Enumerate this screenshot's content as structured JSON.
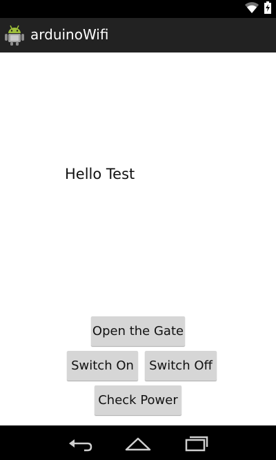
{
  "status_bar": {
    "icons": [
      "wifi-icon",
      "battery-charging-icon"
    ]
  },
  "action_bar": {
    "title": "arduinoWifi",
    "icon": "android-robot-icon"
  },
  "main": {
    "message": "Hello Test",
    "buttons": {
      "open_gate": "Open the Gate",
      "switch_on": "Switch On",
      "switch_off": "Switch Off",
      "check_power": "Check Power"
    },
    "button_color": "#d6d6d6"
  },
  "nav_bar": {
    "icons": [
      "back-icon",
      "home-icon",
      "recent-apps-icon"
    ]
  }
}
